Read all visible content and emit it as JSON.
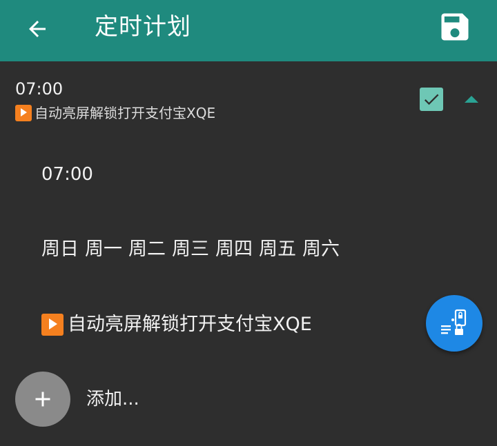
{
  "app_bar": {
    "title": "定时计划",
    "back_icon": "arrow-left-icon",
    "save_icon": "floppy-disk-icon",
    "color": "#1f8a7e"
  },
  "schedule_item": {
    "time": "07:00",
    "task": "自动亮屏解锁打开支付宝XQE",
    "enabled": true,
    "expanded": true,
    "checkbox_color": "#6ec7b5",
    "task_icon": "play-button-icon"
  },
  "details": {
    "time": "07:00",
    "days": [
      "周日",
      "周一",
      "周二",
      "周三",
      "周四",
      "周五",
      "周六"
    ],
    "task": "自动亮屏解锁打开支付宝XQE"
  },
  "add": {
    "label": "添加...",
    "icon": "plus-icon"
  },
  "floating_button": {
    "icon": "phone-unlock-icon",
    "color": "#1e88e5"
  }
}
